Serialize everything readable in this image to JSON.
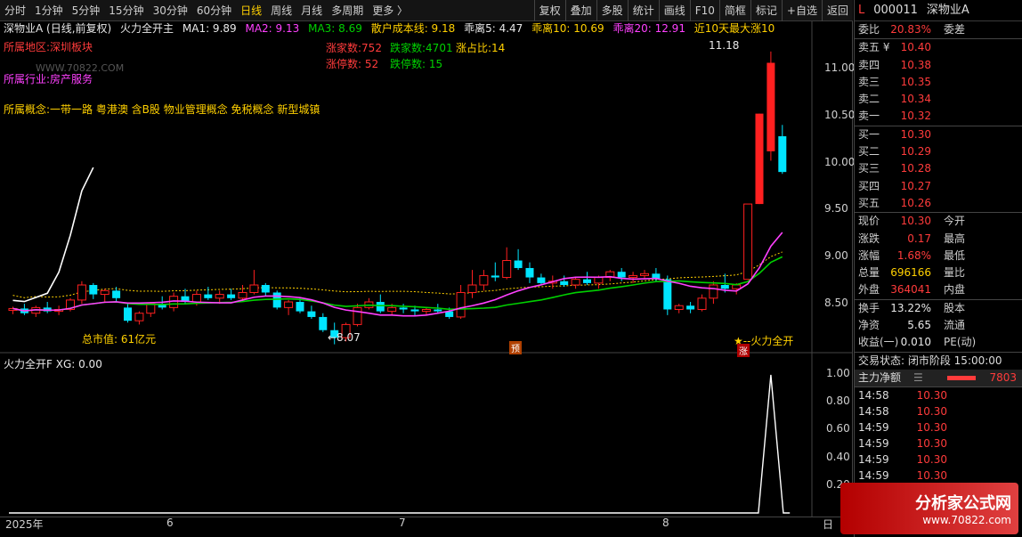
{
  "toolbar": {
    "periods": [
      "分时",
      "1分钟",
      "5分钟",
      "15分钟",
      "30分钟",
      "60分钟",
      "日线",
      "周线",
      "月线",
      "多周期",
      "更多 〉"
    ],
    "active_period": "日线",
    "actions": [
      "复权",
      "叠加",
      "多股",
      "统计",
      "画线",
      "F10",
      "简框",
      "标记",
      "+自选",
      "返回"
    ]
  },
  "main_chart": {
    "title": "深物业A (日线,前复权)",
    "indicator": "火力全开主",
    "ma1": "MA1: 9.89",
    "ma2": "MA2: 9.13",
    "ma3": "MA3: 8.69",
    "cost": "散户成本线: 9.18",
    "guai5": "乖离5: 4.47",
    "guai10": "乖离10: 10.69",
    "guai20": "乖离20: 12.91",
    "max_rise": "近10天最大涨10",
    "region": "所属地区:深圳板块",
    "industry": "所属行业:房产服务",
    "concept": "所属概念:一带一路  粤港澳  含B股  物业管理概念  免税概念  新型城镇",
    "watermark_text": "WWW.70822.COM",
    "up_count": "涨家数:752",
    "down_count": "跌家数:4701",
    "up_ratio": "涨占比:14",
    "limit_up": "涨停数:  52",
    "limit_down": "跌停数:  15",
    "market_cap": "总市值: 61亿元",
    "high_label": "11.18",
    "low_label": "←8.07",
    "signal_label": "★--火力全开",
    "pre_tag": "预",
    "zhang_tag": "涨",
    "y_ticks": [
      "11.00",
      "10.50",
      "10.00",
      "9.50",
      "9.00",
      "8.50"
    ],
    "candle_colors": {
      "up": "#ff2020",
      "down": "#00e5ff",
      "ma1": "#ffffff",
      "ma2": "#ff40ff",
      "ma3": "#00d000",
      "cost": "#ffd000"
    }
  },
  "chart_data": {
    "type": "candlestick",
    "series_ohlc": [
      [
        8.43,
        8.47,
        8.39,
        8.45
      ],
      [
        8.45,
        8.5,
        8.38,
        8.4
      ],
      [
        8.4,
        8.48,
        8.36,
        8.46
      ],
      [
        8.46,
        8.52,
        8.4,
        8.42
      ],
      [
        8.42,
        8.48,
        8.38,
        8.44
      ],
      [
        8.44,
        8.56,
        8.42,
        8.54
      ],
      [
        8.54,
        8.74,
        8.5,
        8.7
      ],
      [
        8.7,
        8.72,
        8.55,
        8.6
      ],
      [
        8.6,
        8.66,
        8.52,
        8.64
      ],
      [
        8.64,
        8.68,
        8.52,
        8.56
      ],
      [
        8.46,
        8.5,
        8.3,
        8.32
      ],
      [
        8.32,
        8.42,
        8.28,
        8.4
      ],
      [
        8.4,
        8.52,
        8.36,
        8.5
      ],
      [
        8.5,
        8.58,
        8.44,
        8.46
      ],
      [
        8.46,
        8.62,
        8.42,
        8.58
      ],
      [
        8.58,
        8.66,
        8.5,
        8.52
      ],
      [
        8.52,
        8.64,
        8.48,
        8.6
      ],
      [
        8.6,
        8.68,
        8.54,
        8.56
      ],
      [
        8.56,
        8.64,
        8.5,
        8.6
      ],
      [
        8.6,
        8.66,
        8.54,
        8.56
      ],
      [
        8.56,
        8.7,
        8.52,
        8.62
      ],
      [
        8.62,
        8.86,
        8.6,
        8.7
      ],
      [
        8.7,
        8.72,
        8.58,
        8.62
      ],
      [
        8.62,
        8.64,
        8.44,
        8.46
      ],
      [
        8.46,
        8.54,
        8.38,
        8.52
      ],
      [
        8.52,
        8.56,
        8.4,
        8.42
      ],
      [
        8.42,
        8.48,
        8.34,
        8.36
      ],
      [
        8.36,
        8.4,
        8.2,
        8.22
      ],
      [
        8.22,
        8.3,
        8.07,
        8.14
      ],
      [
        8.14,
        8.3,
        8.1,
        8.28
      ],
      [
        8.28,
        8.5,
        8.26,
        8.46
      ],
      [
        8.46,
        8.56,
        8.44,
        8.52
      ],
      [
        8.52,
        8.6,
        8.4,
        8.42
      ],
      [
        8.42,
        8.5,
        8.38,
        8.46
      ],
      [
        8.46,
        8.5,
        8.4,
        8.44
      ],
      [
        8.44,
        8.48,
        8.38,
        8.42
      ],
      [
        8.42,
        8.46,
        8.38,
        8.44
      ],
      [
        8.44,
        8.5,
        8.4,
        8.42
      ],
      [
        8.42,
        8.46,
        8.34,
        8.36
      ],
      [
        8.36,
        8.7,
        8.34,
        8.62
      ],
      [
        8.62,
        8.86,
        8.56,
        8.7
      ],
      [
        8.7,
        8.86,
        8.64,
        8.8
      ],
      [
        8.8,
        8.94,
        8.74,
        8.78
      ],
      [
        8.78,
        9.1,
        8.76,
        8.96
      ],
      [
        8.96,
        9.08,
        8.86,
        8.88
      ],
      [
        8.88,
        8.94,
        8.72,
        8.78
      ],
      [
        8.78,
        8.82,
        8.7,
        8.72
      ],
      [
        8.72,
        8.8,
        8.66,
        8.74
      ],
      [
        8.74,
        8.8,
        8.68,
        8.7
      ],
      [
        8.7,
        8.78,
        8.66,
        8.76
      ],
      [
        8.76,
        8.84,
        8.7,
        8.72
      ],
      [
        8.72,
        8.8,
        8.66,
        8.78
      ],
      [
        8.78,
        8.86,
        8.74,
        8.84
      ],
      [
        8.84,
        8.88,
        8.74,
        8.78
      ],
      [
        8.78,
        8.84,
        8.72,
        8.8
      ],
      [
        8.8,
        8.86,
        8.76,
        8.82
      ],
      [
        8.82,
        8.88,
        8.74,
        8.76
      ],
      [
        8.76,
        8.8,
        8.38,
        8.44
      ],
      [
        8.44,
        8.5,
        8.4,
        8.48
      ],
      [
        8.48,
        8.52,
        8.4,
        8.44
      ],
      [
        8.44,
        8.6,
        8.42,
        8.56
      ],
      [
        8.56,
        8.74,
        8.5,
        8.7
      ],
      [
        8.7,
        8.82,
        8.62,
        8.66
      ],
      [
        8.66,
        8.72,
        8.6,
        8.7
      ],
      [
        8.76,
        9.56,
        8.76,
        9.56
      ],
      [
        9.56,
        10.52,
        9.56,
        10.52
      ],
      [
        10.12,
        11.18,
        10.02,
        11.06
      ],
      [
        10.28,
        10.4,
        9.88,
        9.9
      ]
    ],
    "ylim": [
      8.0,
      11.5
    ],
    "x_labels": [
      "2025年",
      "6",
      "7",
      "8",
      "日"
    ]
  },
  "sub_chart": {
    "title": "火力全开F",
    "xg": "XG: 0.00",
    "y_ticks": [
      "1.00",
      "0.80",
      "0.60",
      "0.40",
      "0.20"
    ],
    "spike_index": 66
  },
  "quote": {
    "code_flag": "L",
    "code": "000011",
    "name": "深物业A",
    "webi_label": "委比",
    "webi_value": "20.83%",
    "weicha_label": "委差",
    "asks": [
      {
        "label": "卖五 ¥",
        "price": "10.40"
      },
      {
        "label": "卖四",
        "price": "10.38"
      },
      {
        "label": "卖三",
        "price": "10.35"
      },
      {
        "label": "卖二",
        "price": "10.34"
      },
      {
        "label": "卖一",
        "price": "10.32"
      }
    ],
    "bids": [
      {
        "label": "买一",
        "price": "10.30"
      },
      {
        "label": "买二",
        "price": "10.29"
      },
      {
        "label": "买三",
        "price": "10.28"
      },
      {
        "label": "买四",
        "price": "10.27"
      },
      {
        "label": "买五",
        "price": "10.26"
      }
    ],
    "stats": [
      {
        "l1": "现价",
        "v1": "10.30",
        "l2": "今开",
        "c": "red"
      },
      {
        "l1": "涨跌",
        "v1": "0.17",
        "l2": "最高",
        "c": "red"
      },
      {
        "l1": "涨幅",
        "v1": "1.68%",
        "l2": "最低",
        "c": "red"
      },
      {
        "l1": "总量",
        "v1": "696166",
        "l2": "量比",
        "c": "yellow"
      },
      {
        "l1": "外盘",
        "v1": "364041",
        "l2": "内盘",
        "c": "red"
      }
    ],
    "stats2": [
      {
        "l1": "换手",
        "v1": "13.22%",
        "l2": "股本"
      },
      {
        "l1": "净资",
        "v1": "5.65",
        "l2": "流通"
      },
      {
        "l1": "收益(一)",
        "v1": "0.010",
        "l2": "PE(动)"
      }
    ],
    "trade_state": "交易状态: 闭市阶段 15:00:00",
    "main_net_label": "主力净额",
    "main_net_value": "7803",
    "ticks": [
      {
        "t": "14:58",
        "p": "10.30"
      },
      {
        "t": "14:58",
        "p": "10.30"
      },
      {
        "t": "14:59",
        "p": "10.30"
      },
      {
        "t": "14:59",
        "p": "10.30"
      },
      {
        "t": "14:59",
        "p": "10.30"
      },
      {
        "t": "14:59",
        "p": "10.30"
      }
    ]
  },
  "brand": {
    "title": "分析家公式网",
    "url": "www.70822.com"
  }
}
